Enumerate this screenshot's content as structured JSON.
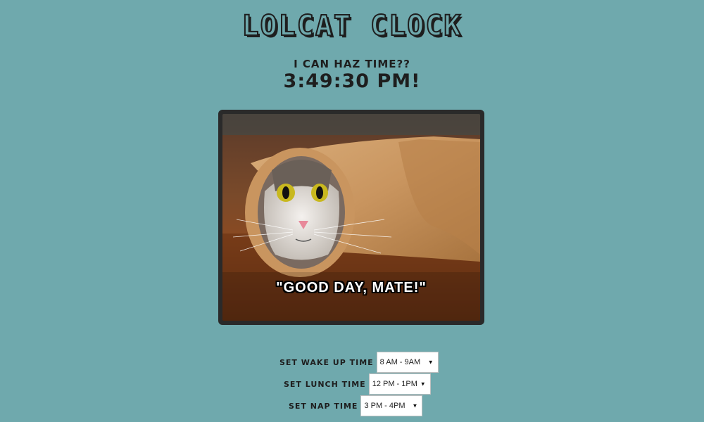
{
  "header": {
    "title": "LOLCAT CLOCK",
    "subtitle": "I CAN HAZ TIME??",
    "time": "3:49:30 PM!"
  },
  "image": {
    "caption": "\"GOOD DAY, MATE!\""
  },
  "settings": {
    "wake": {
      "label": "SET WAKE UP TIME",
      "value": "8 AM - 9AM"
    },
    "lunch": {
      "label": "SET LUNCH TIME",
      "value": "12 PM - 1PM"
    },
    "nap": {
      "label": "SET NAP TIME",
      "value": "3 PM - 4PM"
    }
  },
  "colors": {
    "background": "#6fa9ad",
    "text": "#1e1e1e",
    "frame": "#2a2a2a"
  },
  "icons": {
    "select_arrow": "dropdown-arrow-icon"
  }
}
